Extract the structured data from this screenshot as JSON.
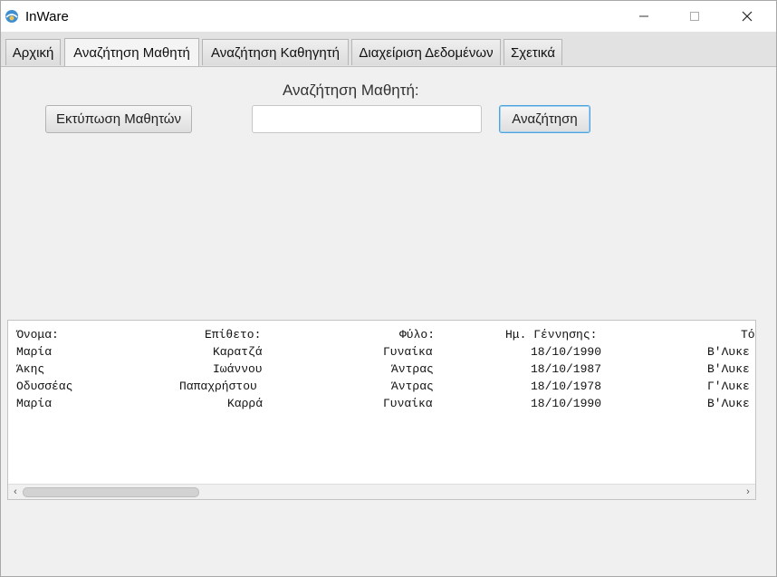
{
  "window": {
    "title": "InWare"
  },
  "tabs": [
    {
      "label": "Αρχική"
    },
    {
      "label": "Αναζήτηση Μαθητή"
    },
    {
      "label": "Αναζήτηση Καθηγητή"
    },
    {
      "label": "Διαχείριση Δεδομένων"
    },
    {
      "label": "Σχετικά"
    }
  ],
  "active_tab": "Αναζήτηση Μαθητή",
  "search": {
    "title": "Αναζήτηση Μαθητή:",
    "value": "",
    "placeholder": "",
    "button_label": "Αναζήτηση",
    "print_button_label": "Εκτύπωση Μαθητών"
  },
  "results": {
    "headers": [
      "Όνομα:",
      "Επίθετο:",
      "Φύλο:",
      "Ημ. Γέννησης:",
      "Τό"
    ],
    "rows": [
      [
        "Μαρία",
        "Καρατζά",
        "Γυναίκα",
        "18/10/1990",
        "Β'Λυκε"
      ],
      [
        "Άκης",
        "Ιωάννου",
        "Άντρας",
        "18/10/1987",
        "Β'Λυκε"
      ],
      [
        "Οδυσσέας",
        "Παπαχρήστου",
        "Άντρας",
        "18/10/1978",
        "Γ'Λυκε"
      ],
      [
        "Μαρία",
        "Καρρά",
        "Γυναίκα",
        "18/10/1990",
        "Β'Λυκε"
      ]
    ]
  },
  "icons": {
    "app": "inware-logo-icon",
    "minimize": "minimize-icon",
    "maximize": "maximize-icon",
    "close": "close-icon",
    "scroll_left": "chevron-left-icon",
    "scroll_right": "chevron-right-icon"
  },
  "colors": {
    "accent": "#4fa3dd",
    "window_bg": "#f0f0f0"
  }
}
